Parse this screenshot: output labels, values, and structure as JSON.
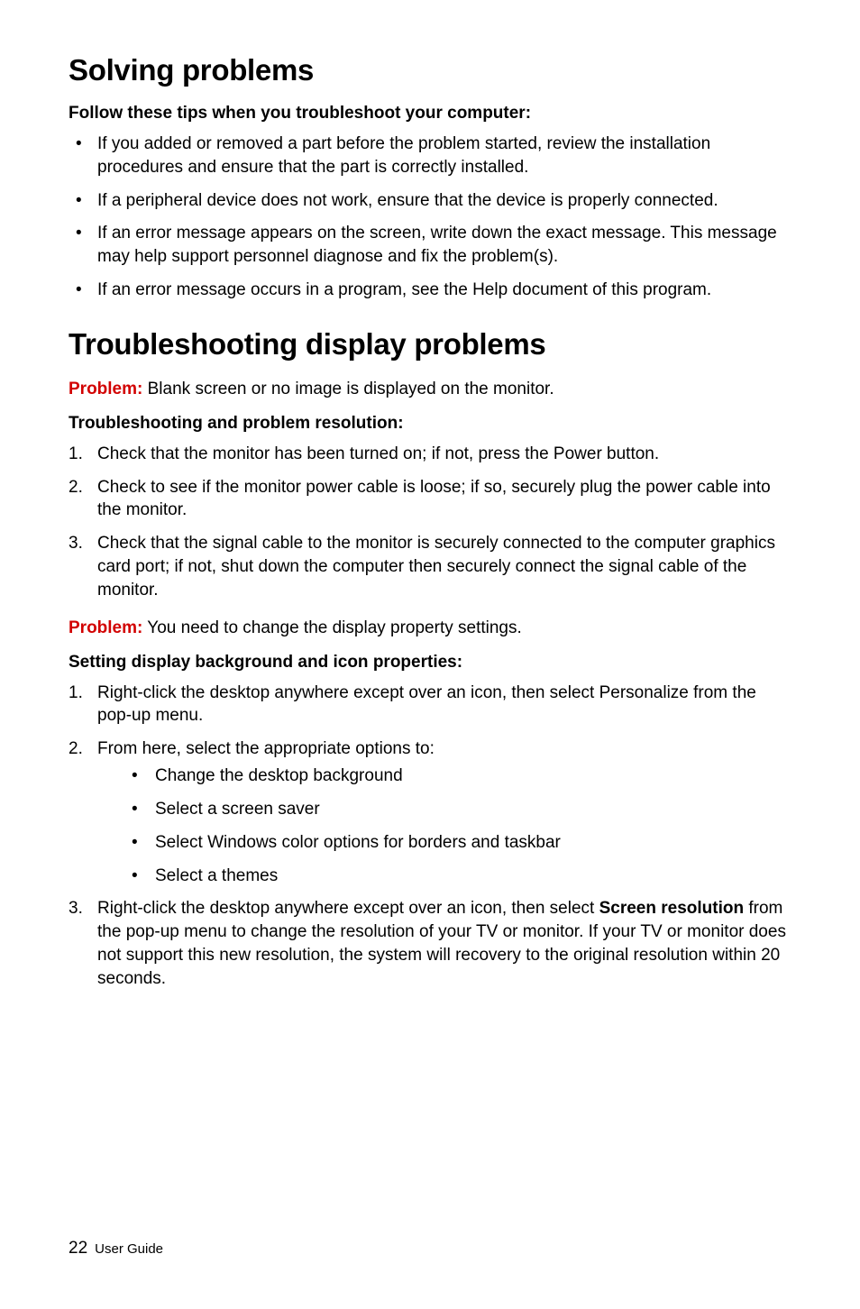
{
  "h1a": "Solving problems",
  "sub1": "Follow these tips when you troubleshoot your computer:",
  "bullets1": [
    "If you added or removed a part before the problem started, review the installation procedures and ensure that the part is correctly installed.",
    "If a peripheral device does not work, ensure that the device is properly connected.",
    "If an error message appears on the screen, write down the exact message. This message may help support personnel diagnose and fix the problem(s).",
    "If an error message occurs in a program, see the Help document of this program."
  ],
  "h1b": "Troubleshooting display problems",
  "problem_label": "Problem:",
  "problem1_text": " Blank screen or no image is displayed on the monitor.",
  "sub2": "Troubleshooting and problem resolution:",
  "numbers1": [
    "Check that the monitor has been turned on; if not, press the Power button.",
    "Check to see if the monitor power cable is loose; if so, securely plug the power cable into the monitor.",
    "Check that the signal cable to the monitor is securely connected to the computer graphics card port; if not, shut down the computer then securely connect the signal cable of the monitor."
  ],
  "problem2_text": " You need to change the display property settings.",
  "sub3": "Setting display background and icon properties:",
  "step2a": "Right-click the desktop anywhere except over an icon, then select Personalize from the pop-up menu.",
  "step2b": "From here, select the appropriate options to:",
  "step2b_sub": [
    "Change the desktop background",
    "Select a screen saver",
    "Select Windows color options for borders and taskbar",
    "Select a themes"
  ],
  "step2c_pre": "Right-click the desktop anywhere except over an icon, then select ",
  "step2c_bold": "Screen resolution",
  "step2c_post": " from the pop-up menu to change the resolution of your TV or monitor. If your TV or monitor does not support this new resolution, the system will recovery to the original resolution within 20 seconds.",
  "footer_page": "22",
  "footer_label": "User Guide"
}
